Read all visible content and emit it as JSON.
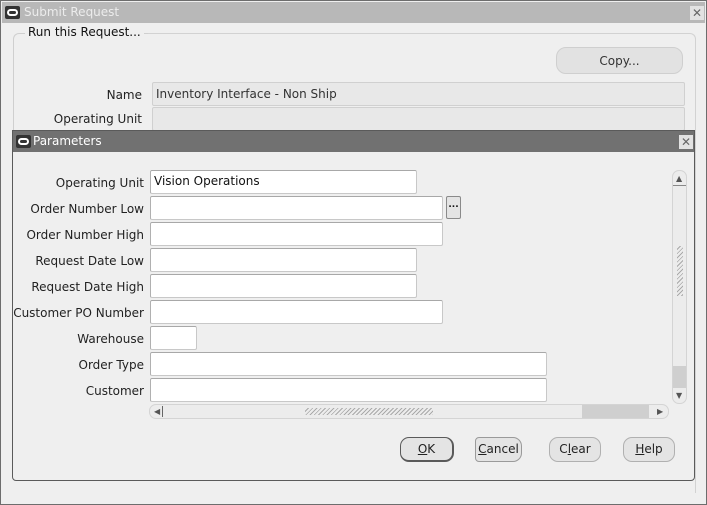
{
  "window": {
    "title": "Submit Request",
    "group_title": "Run this Request...",
    "copy_button": "Copy...",
    "fields": [
      {
        "label": "Name",
        "value": "Inventory Interface - Non Ship"
      },
      {
        "label": "Operating Unit",
        "value": ""
      }
    ]
  },
  "dialog": {
    "title": "Parameters",
    "params": [
      {
        "label": "Operating Unit",
        "value": "Vision Operations"
      },
      {
        "label": "Order Number Low",
        "value": ""
      },
      {
        "label": "Order Number High",
        "value": ""
      },
      {
        "label": "Request Date Low",
        "value": ""
      },
      {
        "label": "Request Date High",
        "value": ""
      },
      {
        "label": "Customer PO Number",
        "value": ""
      },
      {
        "label": "Warehouse",
        "value": ""
      },
      {
        "label": "Order Type",
        "value": ""
      },
      {
        "label": "Customer",
        "value": ""
      }
    ],
    "lov_button": "...",
    "buttons": {
      "ok": {
        "mnemonic": "O",
        "rest": "K"
      },
      "cancel": {
        "mnemonic": "C",
        "rest": "ancel"
      },
      "clear": {
        "pre": "C",
        "mnemonic": "l",
        "rest": "ear"
      },
      "help": {
        "mnemonic": "H",
        "rest": "elp"
      }
    }
  },
  "icons": {
    "close": "✕",
    "scroll_up": "▲",
    "scroll_down": "▼",
    "scroll_left": "◀",
    "scroll_right": "▶"
  }
}
